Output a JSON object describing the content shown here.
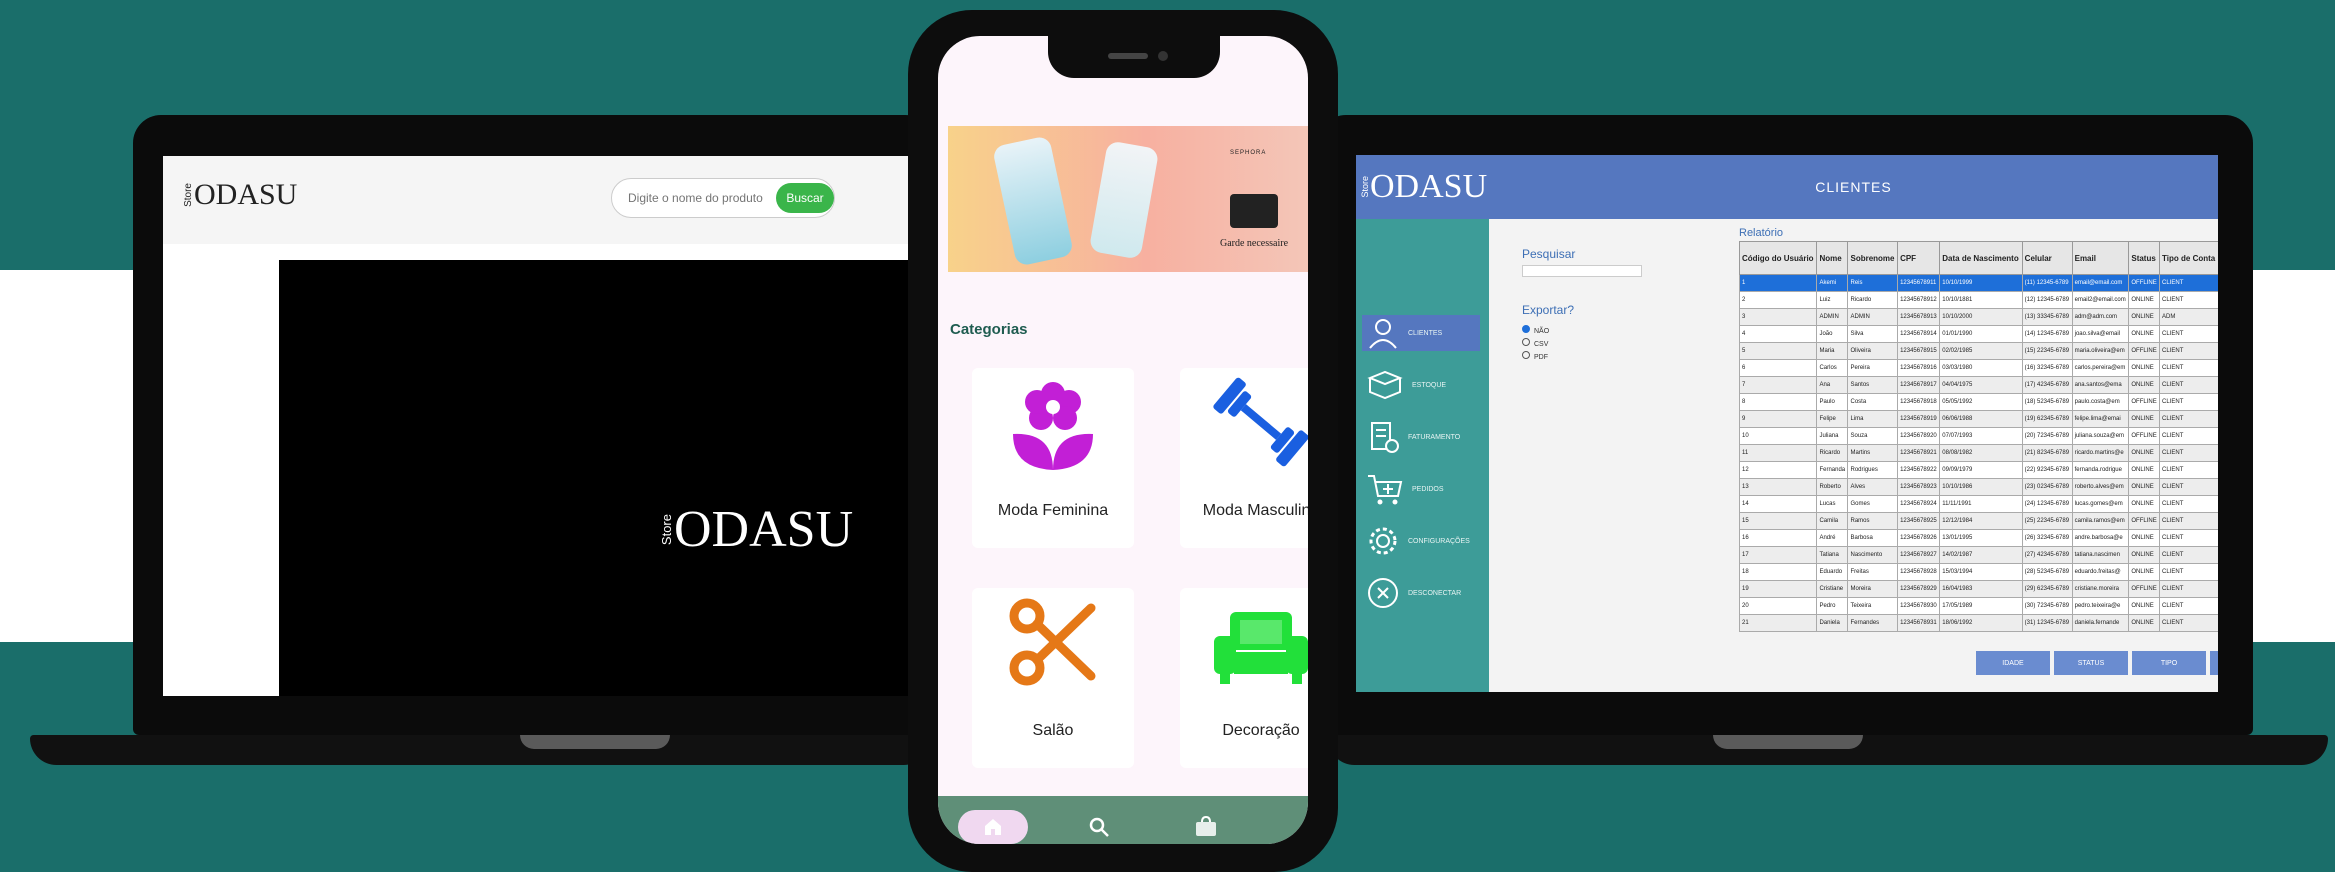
{
  "left_laptop": {
    "logo_store": "Store",
    "logo_name": "ODASU",
    "search_placeholder": "Digite o nome do produto",
    "search_button": "Buscar",
    "hero_logo_store": "Store",
    "hero_logo_name": "ODASU"
  },
  "phone": {
    "banner_brand": "SEPHORA",
    "banner_caption": "Garde necessaire",
    "categories_title": "Categorias",
    "categories": [
      {
        "label": "Moda Feminina",
        "icon": "flower-icon",
        "color": "#c21fd6"
      },
      {
        "label": "Moda Masculina",
        "icon": "dumbbell-icon",
        "color": "#1a5fe0"
      },
      {
        "label": "Salão",
        "icon": "scissors-icon",
        "color": "#e57817"
      },
      {
        "label": "Decoração",
        "icon": "sofa-icon",
        "color": "#22e03a"
      }
    ],
    "nav": {
      "home_icon": "home-icon",
      "search_icon": "search-icon",
      "bag_icon": "shopping-bag-icon"
    }
  },
  "admin": {
    "logo_store": "Store",
    "logo_name": "ODASU",
    "header_title": "CLIENTES",
    "sidebar": [
      {
        "label": "CLIENTES",
        "icon": "user-icon",
        "active": true
      },
      {
        "label": "ESTOQUE",
        "icon": "box-icon",
        "active": false
      },
      {
        "label": "FATURAMENTO",
        "icon": "invoice-icon",
        "active": false
      },
      {
        "label": "PEDIDOS",
        "icon": "cart-icon",
        "active": false
      },
      {
        "label": "CONFIGURAÇÕES",
        "icon": "gear-icon",
        "active": false
      },
      {
        "label": "DESCONECTAR",
        "icon": "logout-icon",
        "active": false
      }
    ],
    "search_label": "Pesquisar",
    "export_label": "Exportar?",
    "export_options": [
      "NÃO",
      "CSV",
      "PDF"
    ],
    "report_title": "Relatório",
    "columns": [
      "Código do Usuário",
      "Nome",
      "Sobrenome",
      "CPF",
      "Data de Nascimento",
      "Celular",
      "Email",
      "Status",
      "Tipo de Conta"
    ],
    "rows": [
      [
        "1",
        "Akemi",
        "Reis",
        "12345678911",
        "10/10/1999",
        "(11) 12345-6789",
        "email@email.com",
        "OFFLINE",
        "CLIENT"
      ],
      [
        "2",
        "Luiz",
        "Ricardo",
        "12345678912",
        "10/10/1881",
        "(12) 12345-6789",
        "email2@email.com",
        "ONLINE",
        "CLIENT"
      ],
      [
        "3",
        "ADMIN",
        "ADMIN",
        "12345678913",
        "10/10/2000",
        "(13) 33345-6789",
        "adm@adm.com",
        "ONLINE",
        "ADM"
      ],
      [
        "4",
        "João",
        "Silva",
        "12345678914",
        "01/01/1990",
        "(14) 12345-6789",
        "joao.silva@email",
        "ONLINE",
        "CLIENT"
      ],
      [
        "5",
        "Maria",
        "Oliveira",
        "12345678915",
        "02/02/1985",
        "(15) 22345-6789",
        "maria.oliveira@em",
        "OFFLINE",
        "CLIENT"
      ],
      [
        "6",
        "Carlos",
        "Pereira",
        "12345678916",
        "03/03/1980",
        "(16) 32345-6789",
        "carlos.pereira@em",
        "ONLINE",
        "CLIENT"
      ],
      [
        "7",
        "Ana",
        "Santos",
        "12345678917",
        "04/04/1975",
        "(17) 42345-6789",
        "ana.santos@ema",
        "ONLINE",
        "CLIENT"
      ],
      [
        "8",
        "Paulo",
        "Costa",
        "12345678918",
        "05/05/1992",
        "(18) 52345-6789",
        "paulo.costa@em",
        "OFFLINE",
        "CLIENT"
      ],
      [
        "9",
        "Felipe",
        "Lima",
        "12345678919",
        "06/06/1988",
        "(19) 62345-6789",
        "felipe.lima@emai",
        "ONLINE",
        "CLIENT"
      ],
      [
        "10",
        "Juliana",
        "Souza",
        "12345678920",
        "07/07/1993",
        "(20) 72345-6789",
        "juliana.souza@em",
        "OFFLINE",
        "CLIENT"
      ],
      [
        "11",
        "Ricardo",
        "Martins",
        "12345678921",
        "08/08/1982",
        "(21) 82345-6789",
        "ricardo.martins@e",
        "ONLINE",
        "CLIENT"
      ],
      [
        "12",
        "Fernanda",
        "Rodrigues",
        "12345678922",
        "09/09/1979",
        "(22) 92345-6789",
        "fernanda.rodrigue",
        "ONLINE",
        "CLIENT"
      ],
      [
        "13",
        "Roberto",
        "Alves",
        "12345678923",
        "10/10/1986",
        "(23) 02345-6789",
        "roberto.alves@em",
        "ONLINE",
        "CLIENT"
      ],
      [
        "14",
        "Lucas",
        "Gomes",
        "12345678924",
        "11/11/1991",
        "(24) 12345-6789",
        "lucas.gomes@em",
        "ONLINE",
        "CLIENT"
      ],
      [
        "15",
        "Camila",
        "Ramos",
        "12345678925",
        "12/12/1984",
        "(25) 22345-6789",
        "camila.ramos@em",
        "OFFLINE",
        "CLIENT"
      ],
      [
        "16",
        "André",
        "Barbosa",
        "12345678926",
        "13/01/1995",
        "(26) 32345-6789",
        "andre.barbosa@e",
        "ONLINE",
        "CLIENT"
      ],
      [
        "17",
        "Tatiana",
        "Nascimento",
        "12345678927",
        "14/02/1987",
        "(27) 42345-6789",
        "tatiana.nascimen",
        "ONLINE",
        "CLIENT"
      ],
      [
        "18",
        "Eduardo",
        "Freitas",
        "12345678928",
        "15/03/1994",
        "(28) 52345-6789",
        "eduardo.freitas@",
        "ONLINE",
        "CLIENT"
      ],
      [
        "19",
        "Cristiane",
        "Moreira",
        "12345678929",
        "16/04/1983",
        "(29) 62345-6789",
        "cristiane.moreira",
        "OFFLINE",
        "CLIENT"
      ],
      [
        "20",
        "Pedro",
        "Teixeira",
        "12345678930",
        "17/05/1989",
        "(30) 72345-6789",
        "pedro.teixeira@e",
        "ONLINE",
        "CLIENT"
      ],
      [
        "21",
        "Daniela",
        "Fernandes",
        "12345678931",
        "18/06/1992",
        "(31) 12345-6789",
        "daniela.fernande",
        "ONLINE",
        "CLIENT"
      ]
    ],
    "table_buttons": [
      "IDADE",
      "STATUS",
      "TIPO"
    ]
  }
}
